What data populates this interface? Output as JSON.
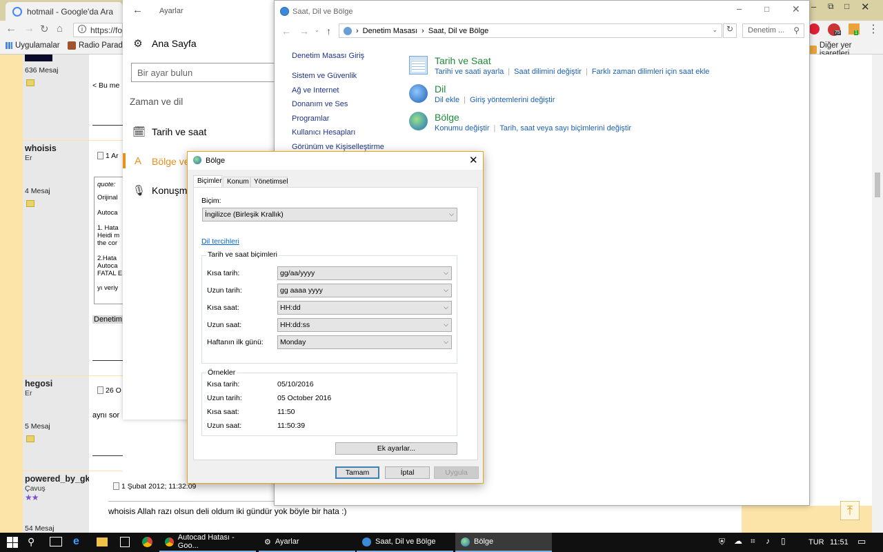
{
  "browser": {
    "tab_title": "hotmail - Google'da Ara",
    "url": "https://fo",
    "bookmarks": [
      "Uygulamalar",
      "Radio Paradis"
    ],
    "other_bookmarks": "Diğer yer işaretleri",
    "badge_75": "75",
    "badge_1": "1"
  },
  "forum": {
    "posts": [
      {
        "name": "",
        "rank": "",
        "messages": "636 Mesaj",
        "date": "",
        "body": "< Bu me"
      },
      {
        "name": "whoisis",
        "rank": "Er",
        "messages": "4 Mesaj",
        "date": "1 Ar",
        "quote_label": "quote:",
        "lines": [
          "Orijinal",
          "Autoca",
          "1. Hata",
          "Heidi m",
          "the cor",
          "2.Hata",
          "Autoca",
          "FATAL E",
          "yı veriy"
        ],
        "footer": "Denetim"
      },
      {
        "name": "hegosi",
        "rank": "Er",
        "messages": "5 Mesaj",
        "date": "26 O",
        "body": "aynı sor"
      },
      {
        "name": "powered_by_gkn",
        "rank": "Çavuş",
        "messages": "54 Mesaj",
        "date": "1 Şubat 2012; 11:32:09",
        "body": "whoisis Allah razı olsun deli oldum iki gündür yok böyle bir hata :)",
        "stars": "★★"
      }
    ],
    "back_to_top": "⤒"
  },
  "settings": {
    "title": "Ayarlar",
    "home": "Ana Sayfa",
    "search_placeholder": "Bir ayar bulun",
    "section": "Zaman ve dil",
    "items": [
      "Tarih ve saat",
      "Bölge ve",
      "Konuşma"
    ]
  },
  "control_panel": {
    "title": "Saat, Dil ve Bölge",
    "breadcrumb": [
      "Denetim Masası",
      "Saat, Dil ve Bölge"
    ],
    "search_placeholder": "Denetim ...",
    "sidebar": [
      "Denetim Masası Giriş",
      "Sistem ve Güvenlik",
      "Ağ ve Internet",
      "Donanım ve Ses",
      "Programlar",
      "Kullanıcı Hesapları",
      "Görünüm ve Kişiselleştirme"
    ],
    "categories": [
      {
        "title": "Tarih ve Saat",
        "links": [
          "Tarihi ve saati ayarla",
          "Saat dilimini değiştir",
          "Farklı zaman dilimleri için saat ekle"
        ]
      },
      {
        "title": "Dil",
        "links": [
          "Dil ekle",
          "Giriş yöntemlerini değiştir"
        ]
      },
      {
        "title": "Bölge",
        "links": [
          "Konumu değiştir",
          "Tarih, saat veya sayı biçimlerini değiştir"
        ]
      }
    ]
  },
  "region_dialog": {
    "title": "Bölge",
    "tabs": [
      "Biçimler",
      "Konum",
      "Yönetimsel"
    ],
    "format_label": "Biçim:",
    "format_value": "İngilizce (Birleşik Krallık)",
    "lang_pref_link": "Dil tercihleri",
    "dt_group": "Tarih ve saat biçimleri",
    "fields": [
      {
        "label": "Kısa tarih:",
        "value": "gg/aa/yyyy"
      },
      {
        "label": "Uzun tarih:",
        "value": "gg aaaa yyyy"
      },
      {
        "label": "Kısa saat:",
        "value": "HH:dd"
      },
      {
        "label": "Uzun saat:",
        "value": "HH:dd:ss"
      },
      {
        "label": "Haftanın ilk günü:",
        "value": "Monday"
      }
    ],
    "examples_group": "Örnekler",
    "examples": [
      {
        "label": "Kısa tarih:",
        "value": "05/10/2016"
      },
      {
        "label": "Uzun tarih:",
        "value": "05 October 2016"
      },
      {
        "label": "Kısa saat:",
        "value": "11:50"
      },
      {
        "label": "Uzun saat:",
        "value": "11:50:39"
      }
    ],
    "extra_button": "Ek ayarlar...",
    "ok": "Tamam",
    "cancel": "İptal",
    "apply": "Uygula"
  },
  "taskbar": {
    "apps": [
      "Autocad Hatası - Goo...",
      "Ayarlar",
      "Saat, Dil ve Bölge",
      "Bölge"
    ],
    "lang": "TUR",
    "time": "11:51"
  }
}
